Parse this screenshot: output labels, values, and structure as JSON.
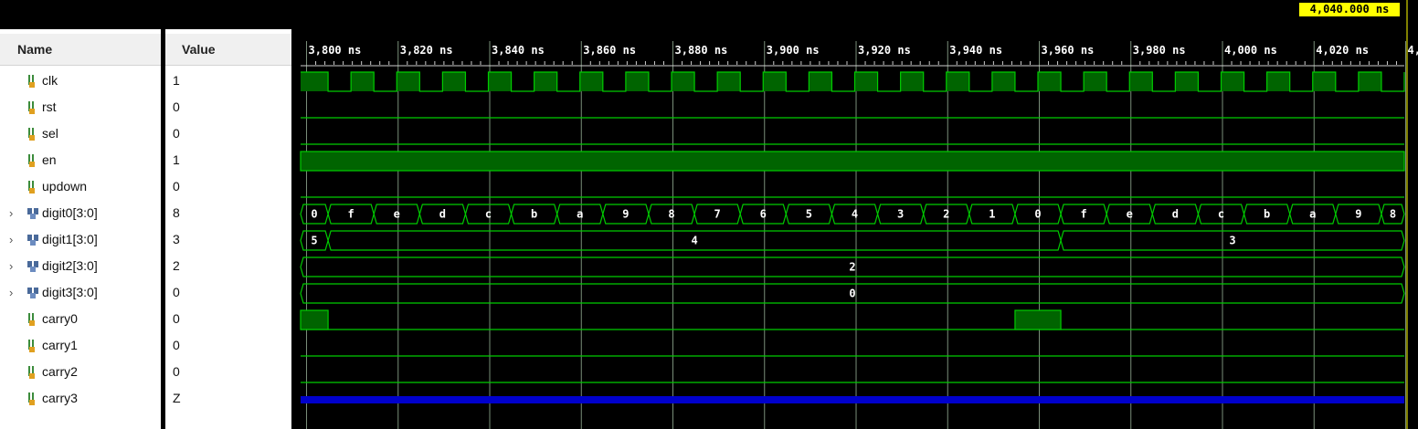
{
  "columns": {
    "name": "Name",
    "value": "Value"
  },
  "signals": [
    {
      "name": "clk",
      "value": "1",
      "kind": "bit",
      "expandable": false
    },
    {
      "name": "rst",
      "value": "0",
      "kind": "bit",
      "expandable": false
    },
    {
      "name": "sel",
      "value": "0",
      "kind": "bit",
      "expandable": false
    },
    {
      "name": "en",
      "value": "1",
      "kind": "bit",
      "expandable": false
    },
    {
      "name": "updown",
      "value": "0",
      "kind": "bit",
      "expandable": false
    },
    {
      "name": "digit0[3:0]",
      "value": "8",
      "kind": "bus",
      "expandable": true
    },
    {
      "name": "digit1[3:0]",
      "value": "3",
      "kind": "bus",
      "expandable": true
    },
    {
      "name": "digit2[3:0]",
      "value": "2",
      "kind": "bus",
      "expandable": true
    },
    {
      "name": "digit3[3:0]",
      "value": "0",
      "kind": "bus",
      "expandable": true
    },
    {
      "name": "carry0",
      "value": "0",
      "kind": "bit",
      "expandable": false
    },
    {
      "name": "carry1",
      "value": "0",
      "kind": "bit",
      "expandable": false
    },
    {
      "name": "carry2",
      "value": "0",
      "kind": "bit",
      "expandable": false
    },
    {
      "name": "carry3",
      "value": "Z",
      "kind": "bit",
      "expandable": false
    }
  ],
  "cursor_time": "4,040.000 ns",
  "timeline": {
    "start_ns": 3798.7,
    "end_ns": 4039.7,
    "tick_labels": [
      "3,800 ns",
      "3,820 ns",
      "3,840 ns",
      "3,860 ns",
      "3,880 ns",
      "3,900 ns",
      "3,920 ns",
      "3,940 ns",
      "3,960 ns",
      "3,980 ns",
      "4,000 ns",
      "4,020 ns",
      "4,"
    ]
  },
  "waves": {
    "clk_edges_ns": [
      3798.7,
      3804.7,
      3809.7,
      3814.7,
      3819.7,
      3824.7,
      3829.7,
      3834.7,
      3839.7,
      3844.7,
      3849.7,
      3854.7,
      3859.7,
      3864.7,
      3869.7,
      3874.7,
      3879.7,
      3884.7,
      3889.7,
      3894.7,
      3899.7,
      3904.7,
      3909.7,
      3914.7,
      3919.7,
      3924.7,
      3929.7,
      3934.7,
      3939.7,
      3944.7,
      3949.7,
      3954.7,
      3959.7,
      3964.7,
      3969.7,
      3974.7,
      3979.7,
      3984.7,
      3989.7,
      3994.7,
      3999.7,
      4004.7,
      4009.7,
      4014.7,
      4019.7,
      4024.7,
      4029.7,
      4034.7,
      4039.7
    ],
    "digit0": [
      "0",
      "f",
      "e",
      "d",
      "c",
      "b",
      "a",
      "9",
      "8",
      "7",
      "6",
      "5",
      "4",
      "3",
      "2",
      "1",
      "0",
      "f",
      "e",
      "d",
      "c",
      "b",
      "a",
      "9",
      "8"
    ],
    "digit0_change_ns": 4.7,
    "digit1": [
      {
        "v": "5",
        "to": 3804.7
      },
      {
        "v": "4",
        "to": 3964.7
      },
      {
        "v": "3",
        "to": 4039.7
      }
    ],
    "digit2": "2",
    "digit3": "0",
    "carry0_high": [
      [
        3798.7,
        3804.7
      ],
      [
        3954.7,
        3964.7
      ]
    ],
    "carry3": "Z"
  },
  "colors": {
    "wave": "#00cc00",
    "fill": "#006400",
    "grid": "#7a8f7a",
    "z": "#0000cc",
    "cursor": "#ffff00"
  }
}
